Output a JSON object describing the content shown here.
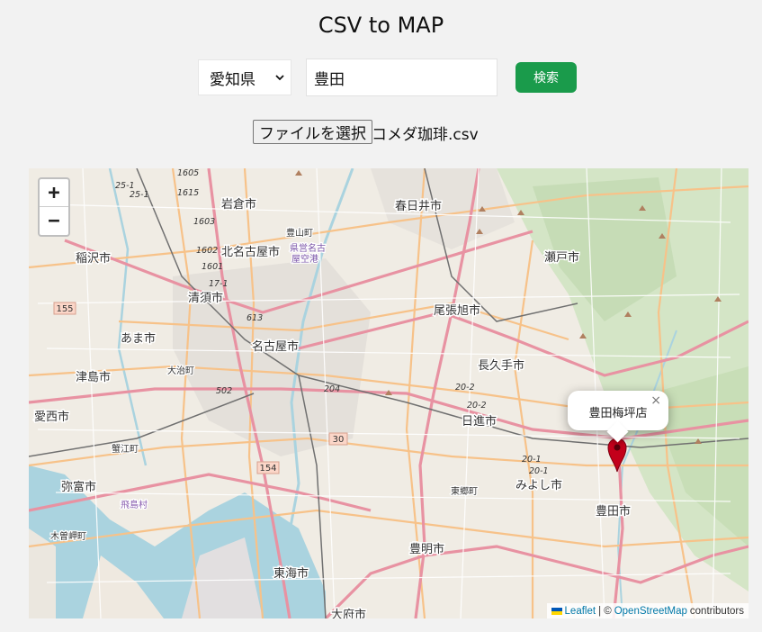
{
  "header": {
    "title": "CSV to MAP"
  },
  "form": {
    "prefecture_selected": "愛知県",
    "city_value": "豊田",
    "search_label": "検索",
    "file_button_label": "ファイルを選択",
    "file_name": "コメダ珈琲.csv"
  },
  "map": {
    "zoom_in_label": "+",
    "zoom_out_label": "−",
    "popup": {
      "text": "豊田梅坪店",
      "close": "×"
    },
    "attribution": {
      "leaflet": "Leaflet",
      "separator": "| ©",
      "osm": "OpenStreetMap",
      "contributors": "contributors"
    },
    "place_labels": [
      "岩倉市",
      "春日井市",
      "北名古屋市",
      "豊山町",
      "県営名古屋空港",
      "稲沢市",
      "瀬戸市",
      "清須市",
      "尾張旭市",
      "あま市",
      "名古屋市",
      "大治町",
      "長久手市",
      "津島市",
      "愛西市",
      "日進市",
      "蟹江町",
      "弥富市",
      "飛島村",
      "みよし市",
      "東郷町",
      "豊田市",
      "木曽岬町",
      "豊明市",
      "東海市",
      "大府市"
    ],
    "road_labels": [
      "155",
      "30",
      "154",
      "25-1",
      "1605",
      "1615",
      "1603",
      "1602",
      "1601",
      "17-1",
      "613",
      "502",
      "204",
      "20-2",
      "20-1"
    ],
    "colors": {
      "primary_road": "#e892a2",
      "secondary_road": "#f7c289",
      "water": "#aad3df",
      "forest": "#cde1c0",
      "marker": "#c3001b"
    }
  }
}
